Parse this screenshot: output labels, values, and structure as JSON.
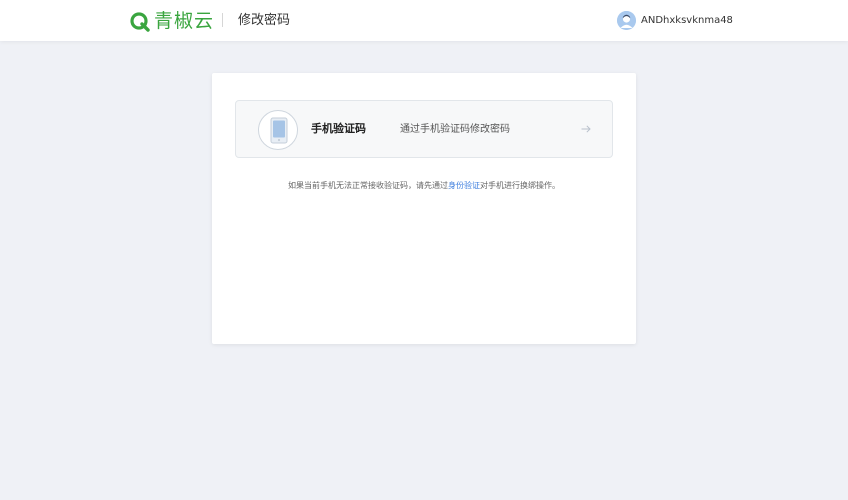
{
  "header": {
    "logo_text": "青椒云",
    "page_title": "修改密码",
    "username": "ANDhxksvknma48"
  },
  "option": {
    "title": "手机验证码",
    "description": "通过手机验证码修改密码"
  },
  "hint": {
    "prefix": "如果当前手机无法正常接收验证码，请先通过",
    "link": "身份验证",
    "suffix": "对手机进行换绑操作。"
  },
  "colors": {
    "brand": "#3aa53f",
    "link": "#3d7ede",
    "background": "#eff1f6"
  },
  "icons": {
    "logo": "q-logo-icon",
    "avatar": "user-avatar-icon",
    "phone": "phone-icon",
    "arrow": "arrow-right-icon"
  }
}
